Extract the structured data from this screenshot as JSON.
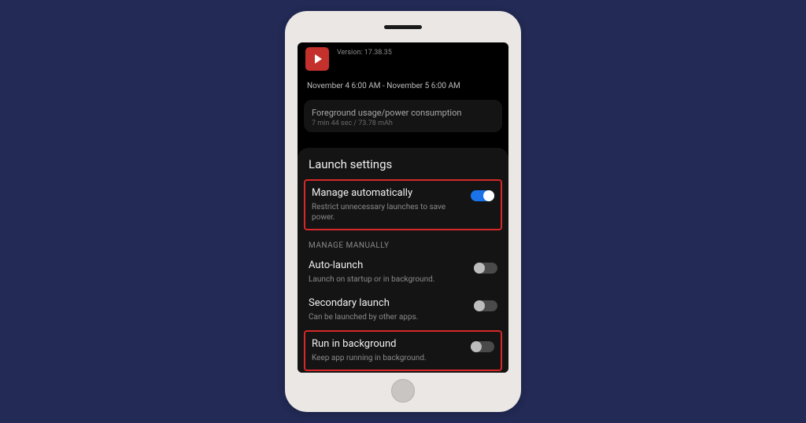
{
  "app": {
    "version_label": "Version: 17.38.35"
  },
  "date_range": "November 4 6:00 AM - November 5 6:00 AM",
  "usage": {
    "title": "Foreground usage/power consumption",
    "sub": "7 min 44 sec / 73.78 mAh"
  },
  "sheet": {
    "title": "Launch settings",
    "manage_auto": {
      "label": "Manage automatically",
      "desc": "Restrict unnecessary launches to save power."
    },
    "manage_manually_heading": "MANAGE MANUALLY",
    "auto_launch": {
      "label": "Auto-launch",
      "desc": "Launch on startup or in background."
    },
    "secondary_launch": {
      "label": "Secondary launch",
      "desc": "Can be launched by other apps."
    },
    "run_bg": {
      "label": "Run in background",
      "desc": "Keep app running in background."
    }
  }
}
